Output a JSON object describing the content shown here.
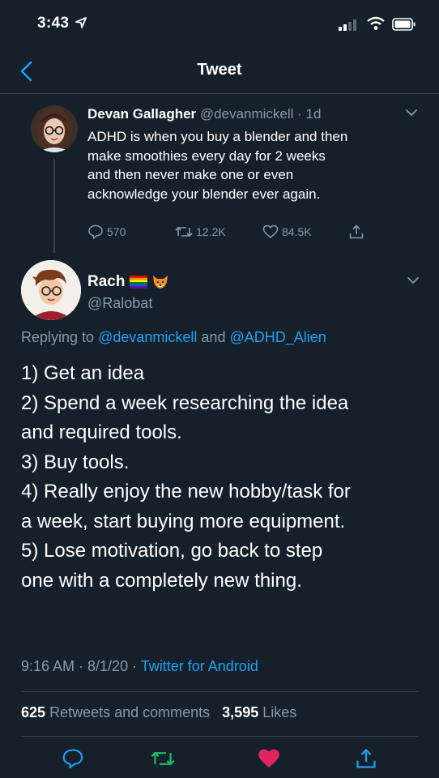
{
  "status_bar": {
    "time": "3:43"
  },
  "nav": {
    "title": "Tweet"
  },
  "parent_tweet": {
    "name": "Devan Gallagher",
    "handle": "@devanmickell",
    "age": "· 1d",
    "lines": [
      "ADHD is when you buy a blender and then",
      "make smoothies every day for 2 weeks",
      "and then never make one or even",
      "acknowledge your blender ever again."
    ],
    "replies": "570",
    "retweets": "12.2K",
    "likes": "84.5K"
  },
  "reply": {
    "name": "Rach",
    "handle": "@Ralobat",
    "replying_prefix": "Replying to",
    "replying_user1": "@devanmickell",
    "replying_and": "and",
    "replying_user2": "@ADHD_Alien",
    "lines": [
      "1) Get an idea",
      "2) Spend a week researching the idea",
      "and required tools.",
      "3) Buy tools.",
      "4) Really enjoy the new hobby/task for",
      "a week, start buying more equipment.",
      "5) Lose motivation, go back to step",
      "one with a completely new thing."
    ],
    "timestamp": "9:16 AM · 8/1/20 ·",
    "source": "Twitter for Android",
    "retweets_count": "625",
    "retweets_label": "Retweets and comments",
    "likes_count": "3,595",
    "likes_label": "Likes"
  },
  "colors": {
    "background": "#15202b",
    "muted": "#8899a6",
    "link": "#1da1f2",
    "retweet_green": "#17bf63",
    "like_red": "#e0245e"
  },
  "icons": [
    "location-arrow-icon",
    "signal-icon",
    "wifi-icon",
    "battery-icon",
    "back-chevron-icon",
    "reply-icon",
    "retweet-icon",
    "heart-icon",
    "share-icon",
    "chevron-down-icon",
    "rainbow-flag-icon",
    "fox-icon"
  ]
}
